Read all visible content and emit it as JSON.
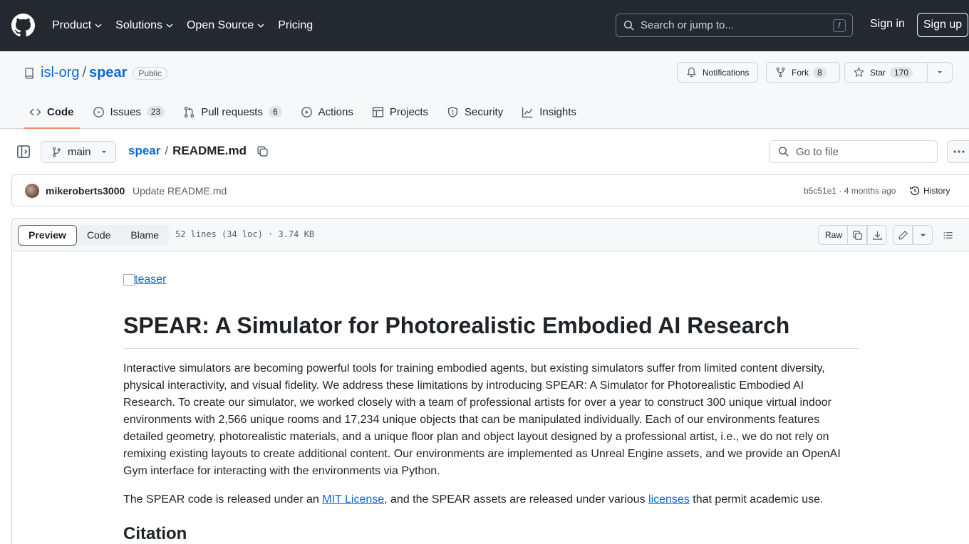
{
  "topnav": {
    "items": [
      "Product",
      "Solutions",
      "Open Source",
      "Pricing"
    ],
    "search_placeholder": "Search or jump to...",
    "search_shortcut": "/",
    "signin": "Sign in",
    "signup": "Sign up"
  },
  "repo": {
    "owner": "isl-org",
    "separator": "/",
    "name": "spear",
    "visibility": "Public",
    "notifications": "Notifications",
    "fork_label": "Fork",
    "fork_count": "8",
    "star_label": "Star",
    "star_count": "170"
  },
  "tabs": [
    {
      "label": "Code"
    },
    {
      "label": "Issues",
      "count": "23"
    },
    {
      "label": "Pull requests",
      "count": "6"
    },
    {
      "label": "Actions"
    },
    {
      "label": "Projects"
    },
    {
      "label": "Security"
    },
    {
      "label": "Insights"
    }
  ],
  "filenav": {
    "branch": "main",
    "crumb_root": "spear",
    "crumb_sep": "/",
    "crumb_file": "README.md",
    "goto_placeholder": "Go to file"
  },
  "commit": {
    "author": "mikeroberts3000",
    "message": "Update README.md",
    "sha_time": "b5c51e1 · 4 months ago",
    "history": "History"
  },
  "filebox": {
    "views": [
      "Preview",
      "Code",
      "Blame"
    ],
    "line_info": "52 lines (34 loc) · 3.74 KB",
    "raw": "Raw"
  },
  "readme": {
    "teaser_alt": "teaser",
    "title": "SPEAR: A Simulator for Photorealistic Embodied AI Research",
    "paragraph1": "Interactive simulators are becoming powerful tools for training embodied agents, but existing simulators suffer from limited content diversity, physical interactivity, and visual fidelity. We address these limitations by introducing SPEAR: A Simulator for Photorealistic Embodied AI Research. To create our simulator, we worked closely with a team of professional artists for over a year to construct 300 unique virtual indoor environments with 2,566 unique rooms and 17,234 unique objects that can be manipulated individually. Each of our environments features detailed geometry, photorealistic materials, and a unique floor plan and object layout designed by a professional artist, i.e., we do not rely on remixing existing layouts to create additional content. Our environments are implemented as Unreal Engine assets, and we provide an OpenAI Gym interface for interacting with the environments via Python.",
    "p2_a": "The SPEAR code is released under an ",
    "p2_link1": "MIT License",
    "p2_b": ", and the SPEAR assets are released under various ",
    "p2_link2": "licenses",
    "p2_c": " that permit academic use.",
    "h2": "Citation"
  }
}
